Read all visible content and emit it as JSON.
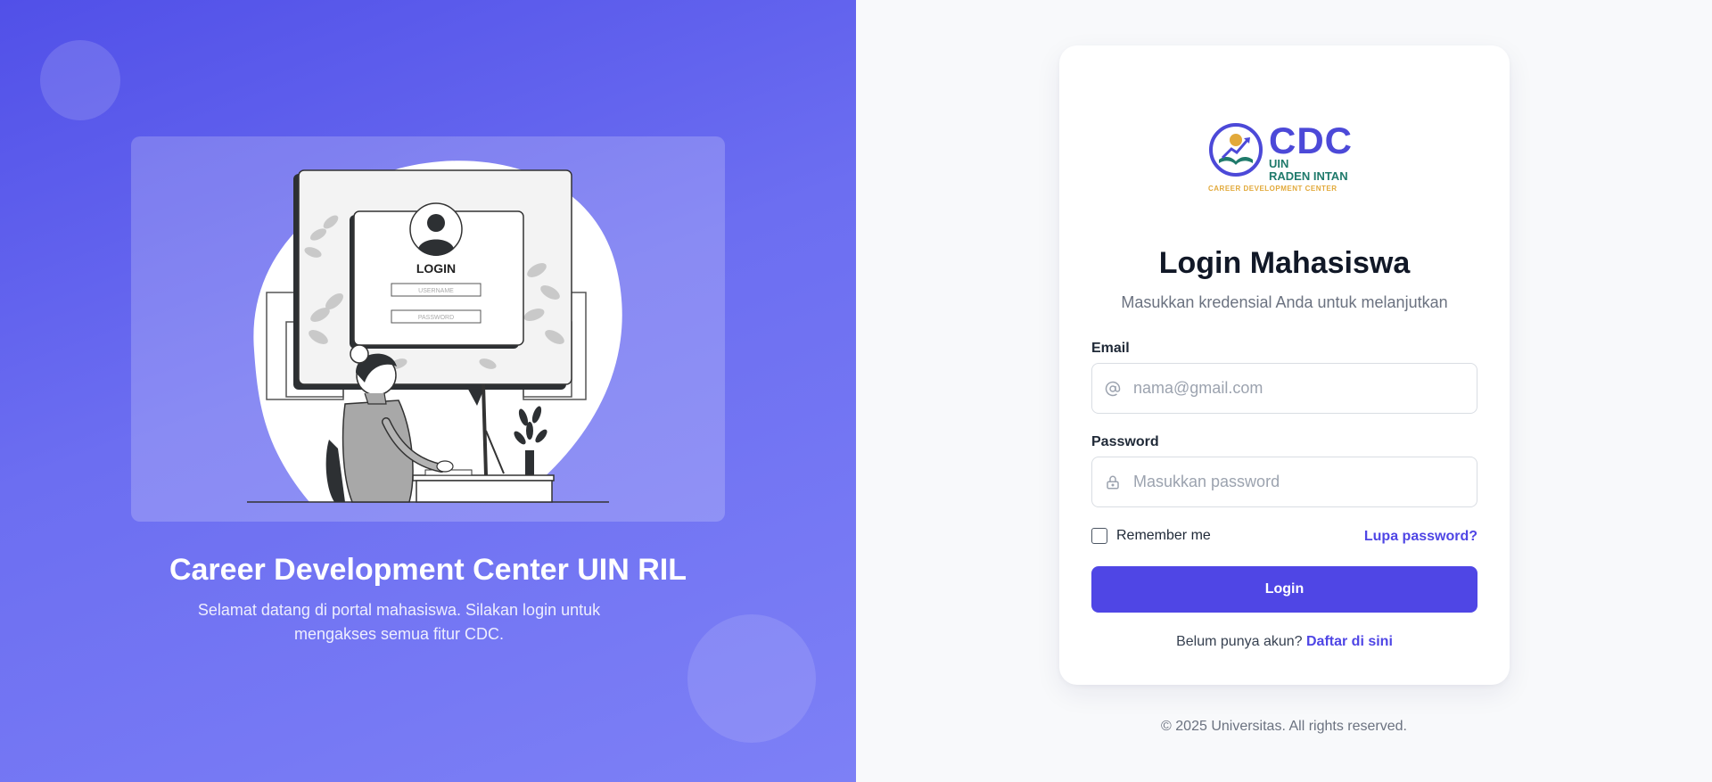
{
  "hero": {
    "title": "Career Development Center UIN RIL",
    "subtitle": "Selamat datang di portal mahasiswa. Silakan login untuk mengakses semua fitur CDC."
  },
  "illustration": {
    "screen_title": "LOGIN",
    "username_field": "USERNAME",
    "password_field": "PASSWORD"
  },
  "logo": {
    "name": "CDC",
    "line1": "UIN",
    "line2": "RADEN INTAN",
    "tagline": "CAREER DEVELOPMENT CENTER"
  },
  "form": {
    "title": "Login Mahasiswa",
    "subtitle": "Masukkan kredensial Anda untuk melanjutkan",
    "email_label": "Email",
    "email_placeholder": "nama@gmail.com",
    "email_icon": "at-icon",
    "password_label": "Password",
    "password_placeholder": "Masukkan password",
    "password_icon": "lock-icon",
    "remember_label": "Remember me",
    "remember_checked": false,
    "forgot_link": "Lupa password?",
    "login_button": "Login",
    "signup_prompt": "Belum punya akun?",
    "signup_link": "Daftar di sini"
  },
  "footer": {
    "copyright": "© 2025 Universitas. All rights reserved."
  },
  "colors": {
    "primary": "#4f46e5",
    "gradient_start": "#5150e8",
    "gradient_end": "#7d80f6",
    "logo_blue": "#4c49d8",
    "logo_green": "#1f7a6b",
    "logo_gold": "#e2a93a"
  }
}
